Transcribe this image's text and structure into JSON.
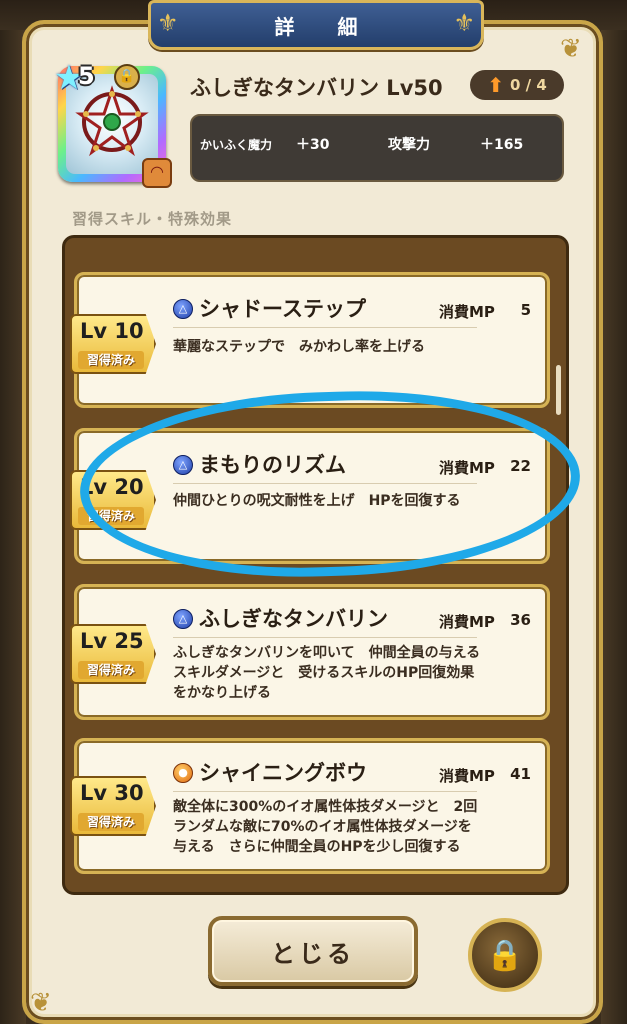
{
  "dialog": {
    "title": "詳 細"
  },
  "item": {
    "stars": "5",
    "name": "ふしぎなタンバリン Lv50",
    "upgrade": "0 / 4",
    "stats": [
      {
        "label": "かいふく魔力",
        "value": "＋30"
      },
      {
        "label": "攻撃力",
        "value": "＋165"
      }
    ]
  },
  "section_label": "習得スキル・特殊効果",
  "skills": [
    {
      "level": "Lv 10",
      "status": "習得済み",
      "element": "blue",
      "name": "シャドーステップ",
      "mp_label": "消費MP",
      "mp": "5",
      "desc": "華麗なステップで　みかわし率を上げる"
    },
    {
      "level": "Lv 20",
      "status": "習得済み",
      "element": "blue",
      "name": "まもりのリズム",
      "mp_label": "消費MP",
      "mp": "22",
      "desc": "仲間ひとりの呪文耐性を上げ　HPを回復する"
    },
    {
      "level": "Lv 25",
      "status": "習得済み",
      "element": "blue",
      "name": "ふしぎなタンバリン",
      "mp_label": "消費MP",
      "mp": "36",
      "desc": "ふしぎなタンバリンを叩いて　仲間全員の与える\nスキルダメージと　受けるスキルのHP回復効果\nをかなり上げる"
    },
    {
      "level": "Lv 30",
      "status": "習得済み",
      "element": "orange",
      "name": "シャイニングボウ",
      "mp_label": "消費MP",
      "mp": "41",
      "desc": "敵全体に300%のイオ属性体技ダメージと　2回\nランダムな敵に70%のイオ属性体技ダメージを\n与える　さらに仲間全員のHPを少し回復する"
    }
  ],
  "buttons": {
    "close": "とじる"
  },
  "colors": {
    "highlight_circle": "#1fa9e8",
    "panel_bg": "#f2ead6",
    "gold_border": "#d6b354"
  }
}
